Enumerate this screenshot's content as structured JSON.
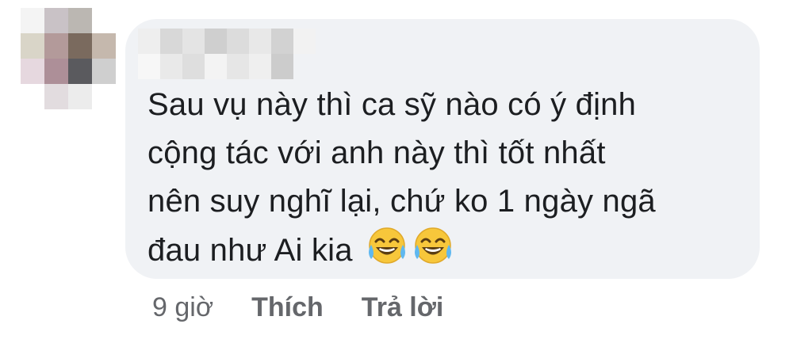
{
  "comment": {
    "lines": [
      "Sau vụ này thì ca sỹ nào có ý định",
      "cộng tác với anh này thì tốt nhất",
      "nên suy nghĩ lại, chứ ko 1 ngày ngã",
      "đau như Ai kia"
    ],
    "emojis": [
      "face-with-tears-of-joy-icon",
      "face-with-tears-of-joy-icon"
    ],
    "bubble_color": "#f0f2f5",
    "text_color": "#1c1e21"
  },
  "actions": {
    "timestamp": "9 giờ",
    "like_label": "Thích",
    "reply_label": "Trả lời",
    "color": "#65676b"
  },
  "avatar": {
    "pixels": [
      "#f4f4f4",
      "#c9c2c6",
      "#bbb7b2",
      "#ffffff",
      "#d9d5c8",
      "#b39a9a",
      "#7a6a5e",
      "#c5b8ad",
      "#e6d8df",
      "#ad8f98",
      "#5a5a5e",
      "#cfcfcf",
      "#ffffff",
      "#e2dcdf",
      "#ececec",
      "#ffffff"
    ]
  },
  "name_blur": {
    "pixels": [
      "#eeeeee",
      "#d8d8d8",
      "#e4e4e4",
      "#cfcfcf",
      "#dcdcdc",
      "#e8e8e8",
      "#d2d2d2",
      "#f2f2f2",
      "#f7f7f7",
      "#e9e9e9",
      "#dedede",
      "#f3f3f3",
      "#e6e6e6",
      "#efefef",
      "#cccccc",
      "#f0f2f5"
    ]
  }
}
